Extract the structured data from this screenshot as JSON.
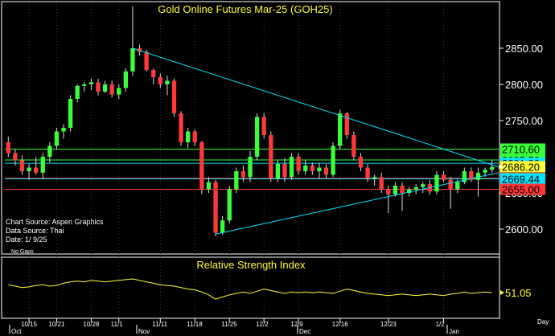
{
  "chart_data": [
    {
      "type": "candlestick",
      "title": "Gold Online Futures Mar-25 (GOH25)",
      "info": {
        "source_line": "Chart Source: Aspen Graphics",
        "data_source_line": "Data Source: Thai",
        "date_line": "Date:    1/ 9/25",
        "no_gaps": "No Gaps"
      },
      "y_ticks": [
        "2850.00",
        "2800.00",
        "2750.00",
        "2700.00",
        "2650.00",
        "2600.00"
      ],
      "ylim": [
        2570,
        2910
      ],
      "candles": [
        {
          "o": 2720,
          "h": 2728,
          "l": 2700,
          "c": 2705
        },
        {
          "o": 2705,
          "h": 2710,
          "l": 2688,
          "c": 2695
        },
        {
          "o": 2695,
          "h": 2702,
          "l": 2675,
          "c": 2680
        },
        {
          "o": 2680,
          "h": 2690,
          "l": 2668,
          "c": 2685
        },
        {
          "o": 2685,
          "h": 2700,
          "l": 2675,
          "c": 2678
        },
        {
          "o": 2678,
          "h": 2705,
          "l": 2670,
          "c": 2700
        },
        {
          "o": 2700,
          "h": 2720,
          "l": 2692,
          "c": 2715
        },
        {
          "o": 2715,
          "h": 2740,
          "l": 2710,
          "c": 2735
        },
        {
          "o": 2735,
          "h": 2745,
          "l": 2725,
          "c": 2740
        },
        {
          "o": 2740,
          "h": 2785,
          "l": 2735,
          "c": 2780
        },
        {
          "o": 2780,
          "h": 2800,
          "l": 2775,
          "c": 2798
        },
        {
          "o": 2798,
          "h": 2803,
          "l": 2790,
          "c": 2800
        },
        {
          "o": 2800,
          "h": 2808,
          "l": 2792,
          "c": 2803
        },
        {
          "o": 2803,
          "h": 2808,
          "l": 2785,
          "c": 2790
        },
        {
          "o": 2790,
          "h": 2805,
          "l": 2788,
          "c": 2800
        },
        {
          "o": 2800,
          "h": 2805,
          "l": 2782,
          "c": 2786
        },
        {
          "o": 2786,
          "h": 2800,
          "l": 2780,
          "c": 2795
        },
        {
          "o": 2795,
          "h": 2822,
          "l": 2790,
          "c": 2818
        },
        {
          "o": 2818,
          "h": 2908,
          "l": 2812,
          "c": 2850
        },
        {
          "o": 2850,
          "h": 2855,
          "l": 2840,
          "c": 2845
        },
        {
          "o": 2845,
          "h": 2848,
          "l": 2818,
          "c": 2820
        },
        {
          "o": 2820,
          "h": 2822,
          "l": 2800,
          "c": 2810
        },
        {
          "o": 2810,
          "h": 2815,
          "l": 2795,
          "c": 2800
        },
        {
          "o": 2800,
          "h": 2812,
          "l": 2785,
          "c": 2805
        },
        {
          "o": 2805,
          "h": 2808,
          "l": 2755,
          "c": 2760
        },
        {
          "o": 2760,
          "h": 2763,
          "l": 2715,
          "c": 2720
        },
        {
          "o": 2720,
          "h": 2740,
          "l": 2712,
          "c": 2735
        },
        {
          "o": 2735,
          "h": 2738,
          "l": 2715,
          "c": 2720
        },
        {
          "o": 2720,
          "h": 2722,
          "l": 2648,
          "c": 2655
        },
        {
          "o": 2655,
          "h": 2672,
          "l": 2650,
          "c": 2665
        },
        {
          "o": 2665,
          "h": 2668,
          "l": 2590,
          "c": 2595
        },
        {
          "o": 2595,
          "h": 2618,
          "l": 2592,
          "c": 2612
        },
        {
          "o": 2612,
          "h": 2660,
          "l": 2608,
          "c": 2655
        },
        {
          "o": 2655,
          "h": 2685,
          "l": 2650,
          "c": 2680
        },
        {
          "o": 2680,
          "h": 2688,
          "l": 2665,
          "c": 2672
        },
        {
          "o": 2672,
          "h": 2708,
          "l": 2665,
          "c": 2700
        },
        {
          "o": 2700,
          "h": 2760,
          "l": 2695,
          "c": 2755
        },
        {
          "o": 2755,
          "h": 2760,
          "l": 2725,
          "c": 2730
        },
        {
          "o": 2730,
          "h": 2735,
          "l": 2665,
          "c": 2670
        },
        {
          "o": 2670,
          "h": 2695,
          "l": 2665,
          "c": 2690
        },
        {
          "o": 2690,
          "h": 2698,
          "l": 2665,
          "c": 2672
        },
        {
          "o": 2672,
          "h": 2705,
          "l": 2668,
          "c": 2700
        },
        {
          "o": 2700,
          "h": 2705,
          "l": 2675,
          "c": 2680
        },
        {
          "o": 2680,
          "h": 2695,
          "l": 2675,
          "c": 2688
        },
        {
          "o": 2688,
          "h": 2692,
          "l": 2675,
          "c": 2680
        },
        {
          "o": 2680,
          "h": 2692,
          "l": 2670,
          "c": 2685
        },
        {
          "o": 2685,
          "h": 2690,
          "l": 2670,
          "c": 2675
        },
        {
          "o": 2675,
          "h": 2720,
          "l": 2672,
          "c": 2715
        },
        {
          "o": 2715,
          "h": 2765,
          "l": 2710,
          "c": 2760
        },
        {
          "o": 2760,
          "h": 2762,
          "l": 2725,
          "c": 2730
        },
        {
          "o": 2730,
          "h": 2735,
          "l": 2695,
          "c": 2700
        },
        {
          "o": 2700,
          "h": 2705,
          "l": 2680,
          "c": 2685
        },
        {
          "o": 2685,
          "h": 2690,
          "l": 2665,
          "c": 2670
        },
        {
          "o": 2670,
          "h": 2675,
          "l": 2660,
          "c": 2672
        },
        {
          "o": 2672,
          "h": 2678,
          "l": 2650,
          "c": 2655
        },
        {
          "o": 2655,
          "h": 2660,
          "l": 2622,
          "c": 2648
        },
        {
          "o": 2648,
          "h": 2665,
          "l": 2645,
          "c": 2660
        },
        {
          "o": 2660,
          "h": 2665,
          "l": 2625,
          "c": 2650
        },
        {
          "o": 2650,
          "h": 2658,
          "l": 2645,
          "c": 2655
        },
        {
          "o": 2655,
          "h": 2662,
          "l": 2648,
          "c": 2658
        },
        {
          "o": 2658,
          "h": 2665,
          "l": 2650,
          "c": 2662
        },
        {
          "o": 2662,
          "h": 2668,
          "l": 2648,
          "c": 2652
        },
        {
          "o": 2652,
          "h": 2680,
          "l": 2648,
          "c": 2675
        },
        {
          "o": 2675,
          "h": 2680,
          "l": 2665,
          "c": 2668
        },
        {
          "o": 2668,
          "h": 2672,
          "l": 2628,
          "c": 2655
        },
        {
          "o": 2655,
          "h": 2668,
          "l": 2650,
          "c": 2665
        },
        {
          "o": 2665,
          "h": 2685,
          "l": 2662,
          "c": 2680
        },
        {
          "o": 2680,
          "h": 2685,
          "l": 2665,
          "c": 2668
        },
        {
          "o": 2668,
          "h": 2685,
          "l": 2645,
          "c": 2678
        },
        {
          "o": 2678,
          "h": 2685,
          "l": 2672,
          "c": 2682
        },
        {
          "o": 2682,
          "h": 2695,
          "l": 2678,
          "c": 2686
        }
      ],
      "trendlines": [
        {
          "from": [
            18,
            2850
          ],
          "to": [
            70,
            2686
          ]
        },
        {
          "from": [
            30,
            2593
          ],
          "to": [
            70,
            2678
          ]
        }
      ],
      "horizontal_lines": [
        {
          "value": 2710.6,
          "color": "#39ff39"
        },
        {
          "value": 2695.5,
          "color": "#39ff39"
        },
        {
          "value": 2691.0,
          "color": "#00e5ff"
        },
        {
          "value": 2670.33,
          "color": "#ff3838"
        },
        {
          "value": 2669.44,
          "color": "#00e5ff"
        },
        {
          "value": 2655.0,
          "color": "#ff3838"
        }
      ],
      "price_labels": [
        {
          "text": "2710.60",
          "bg": "#39ff39"
        },
        {
          "text": "2695.50",
          "bg": "#39ff39"
        },
        {
          "text": "2691.00",
          "bg": "#00e5ff"
        },
        {
          "text": "2686.20",
          "bg": "#ffff33"
        },
        {
          "text": "2670.33",
          "bg": "#ff3838"
        },
        {
          "text": "2669.44",
          "bg": "#00e5ff"
        },
        {
          "text": "2655.00",
          "bg": "#ff3838"
        }
      ],
      "colors": {
        "up": "#39ff39",
        "down": "#ff3838",
        "trend": "#00e5ff",
        "title": "#ffff33"
      }
    },
    {
      "type": "line",
      "title": "Relative Strength Index",
      "value_label": "51.05",
      "ylim": [
        20,
        80
      ],
      "values": [
        62,
        60,
        58,
        59,
        61,
        62,
        60,
        61,
        64,
        66,
        67,
        66,
        68,
        67,
        66,
        67,
        68,
        69,
        70,
        68,
        66,
        64,
        62,
        61,
        60,
        58,
        56,
        55,
        52,
        48,
        42,
        45,
        48,
        50,
        52,
        50,
        53,
        56,
        54,
        52,
        50,
        52,
        51,
        52,
        51,
        52,
        51,
        50,
        53,
        56,
        54,
        52,
        50,
        49,
        48,
        47,
        48,
        49,
        48,
        47,
        48,
        49,
        48,
        47,
        49,
        50,
        52,
        50,
        51,
        52,
        51.05
      ],
      "colors": {
        "line": "#ffff33",
        "title": "#ffff33"
      }
    }
  ],
  "x_axis": {
    "date_ticks": [
      "10/15",
      "10/21",
      "10/28",
      "11/1",
      "11/11",
      "11/18",
      "11/25",
      "12/2",
      "12/9",
      "12/16",
      "12/23",
      "1/2"
    ],
    "month_labels": [
      "Oct",
      "Nov",
      "Dec",
      "Jan"
    ],
    "unit_label": "Day"
  }
}
